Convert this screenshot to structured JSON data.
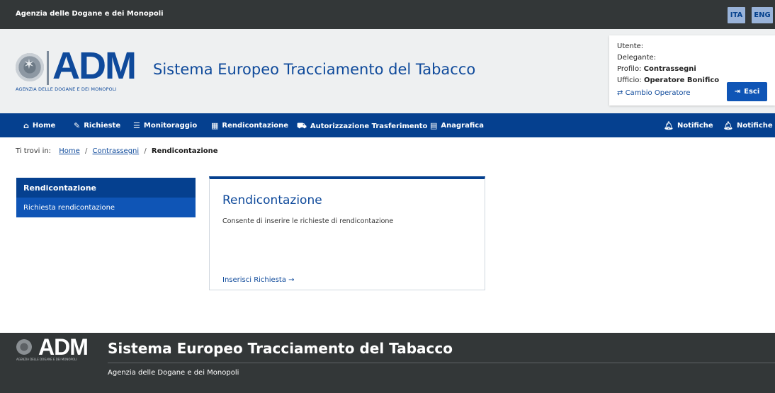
{
  "topbar": {
    "agency": "Agenzia delle Dogane e dei Monopoli",
    "lang_ita": "ITA",
    "lang_eng": "ENG"
  },
  "header": {
    "logo_text": "ADM",
    "logo_sub": "AGENZIA DELLE DOGANE E DEI MONOPOLI",
    "site_title": "Sistema Europeo Tracciamento del Tabacco"
  },
  "user": {
    "utente_label": "Utente:",
    "delegante_label": "Delegante:",
    "profilo_label": "Profilo:",
    "profilo_value": "Contrassegni",
    "ufficio_label": "Ufficio:",
    "ufficio_value": "Operatore Bonifico",
    "cambio": "Cambio Operatore",
    "esci": "Esci"
  },
  "nav": {
    "items": [
      {
        "label": "Home",
        "icon": "home-icon"
      },
      {
        "label": "Richieste",
        "icon": "edit-icon"
      },
      {
        "label": "Monitoraggio",
        "icon": "list-icon"
      },
      {
        "label": "Rendicontazione",
        "icon": "calculator-icon"
      },
      {
        "label": "Autorizzazione Trasferimento",
        "icon": "truck-icon"
      },
      {
        "label": "Anagrafica",
        "icon": "file-icon"
      }
    ],
    "right": [
      {
        "label": "Notifiche",
        "icon": "bell-icon"
      },
      {
        "label": "Notifiche",
        "icon": "bell-icon"
      }
    ]
  },
  "breadcrumb": {
    "label": "Ti trovi in:",
    "home": "Home",
    "contrassegni": "Contrassegni",
    "current": "Rendicontazione"
  },
  "sidemenu": {
    "title": "Rendicontazione",
    "item": "Richiesta rendicontazione"
  },
  "card": {
    "title": "Rendicontazione",
    "description": "Consente di inserire le richieste di rendicontazione",
    "link": "Inserisci Richiesta"
  },
  "footer": {
    "logo_text": "ADM",
    "logo_sub": "AGENZIA DELLE DOGANE E DEI MONOPOLI",
    "title": "Sistema Europeo Tracciamento del Tabacco",
    "subtitle": "Agenzia delle Dogane e dei Monopoli"
  },
  "colors": {
    "primary": "#05408f",
    "accent": "#0f55b6",
    "dark": "#333738"
  }
}
